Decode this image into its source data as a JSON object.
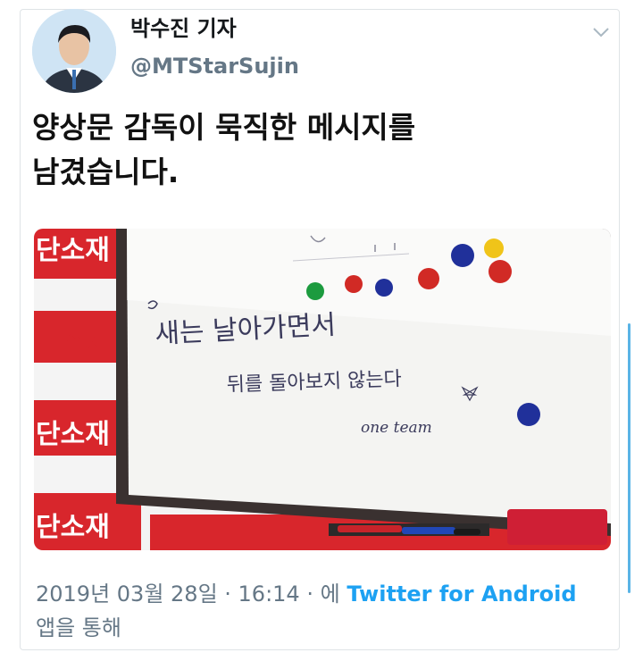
{
  "tweet": {
    "author_name": "박수진 기자",
    "author_handle": "@MTStarSujin",
    "text_line1": "양상문 감독이 묵직한 메시지를",
    "text_line2": "남겼습니다.",
    "timestamp": "2019년 03월 28일 · 16:14 · 에",
    "source": "Twitter for Android",
    "source_suffix": "앱을 통해"
  },
  "photo": {
    "wall_text": [
      "단소재",
      "단소재",
      "단소재",
      "단소재"
    ],
    "board_line1": "새는 날아가면서",
    "board_line2": "뒤를 돌아보지 않는다",
    "board_signature": "one team"
  },
  "colors": {
    "link": "#1da1f2",
    "secondary_text": "#657786",
    "wall_red": "#d8262c"
  }
}
